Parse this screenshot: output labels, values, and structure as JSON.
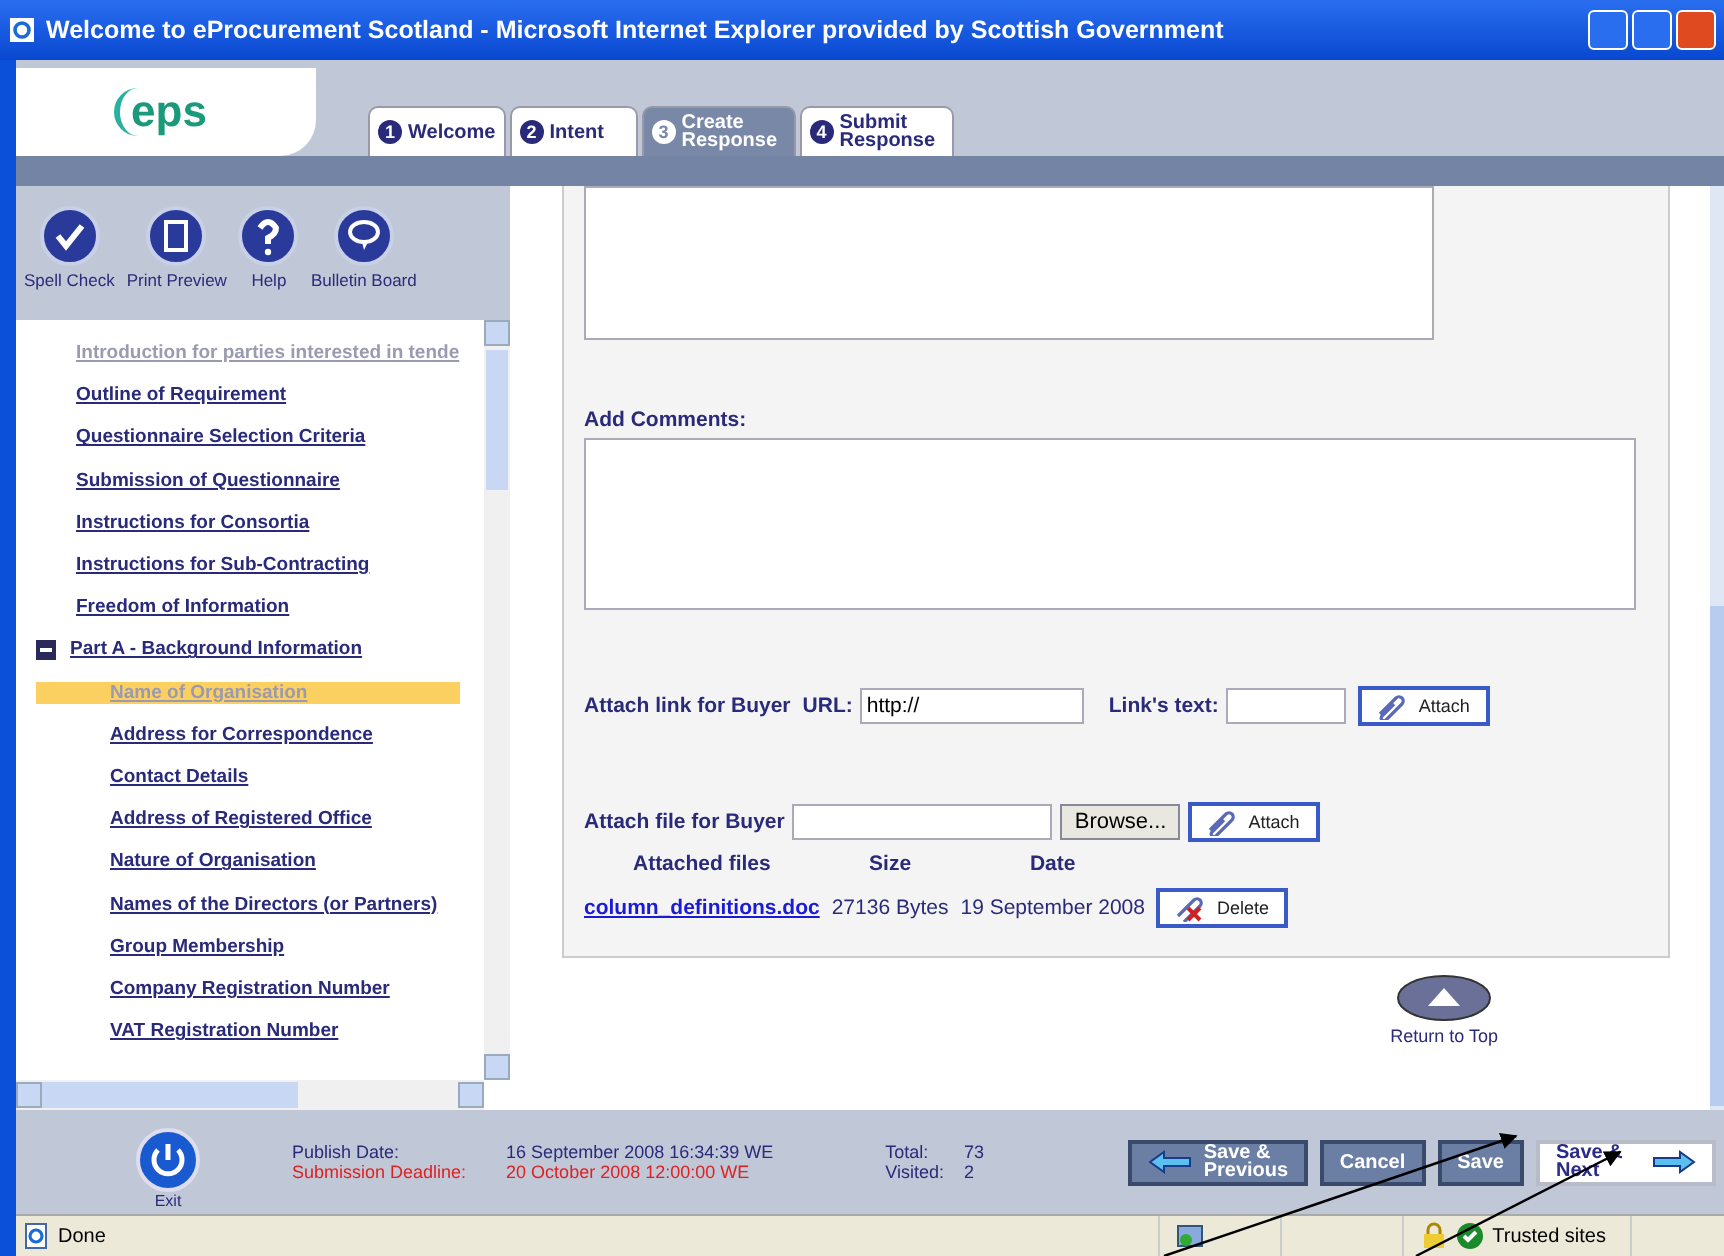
{
  "window": {
    "title": "Welcome to eProcurement Scotland - Microsoft Internet Explorer provided by Scottish Government"
  },
  "logo": {
    "text": "eps"
  },
  "tabs": [
    {
      "number": "1",
      "label": "Welcome",
      "selected": false
    },
    {
      "number": "2",
      "label": "Intent",
      "selected": false
    },
    {
      "number": "3",
      "label": "Create Response",
      "selected": true
    },
    {
      "number": "4",
      "label": "Submit Response",
      "selected": false
    }
  ],
  "toolbar": [
    {
      "kind": "spell",
      "label": "Spell Check"
    },
    {
      "kind": "print",
      "label": "Print Preview"
    },
    {
      "kind": "help",
      "label": "Help"
    },
    {
      "kind": "bulletin",
      "label": "Bulletin Board"
    }
  ],
  "tree": [
    {
      "label": "Introduction for parties interested in tende",
      "visited": true,
      "selected": false
    },
    {
      "label": "Outline of Requirement",
      "visited": false,
      "selected": false
    },
    {
      "label": "Questionnaire Selection Criteria",
      "visited": false,
      "selected": false
    },
    {
      "label": "Submission of Questionnaire",
      "visited": false,
      "selected": false
    },
    {
      "label": "Instructions for Consortia",
      "visited": false,
      "selected": false
    },
    {
      "label": "Instructions for Sub-Contracting",
      "visited": false,
      "selected": false
    },
    {
      "label": "Freedom of Information",
      "visited": false,
      "selected": false
    },
    {
      "label": "Part A - Background Information",
      "visited": false,
      "selected": false,
      "expanded": true,
      "children": [
        {
          "label": "Name of Organisation",
          "visited": true,
          "selected": true
        },
        {
          "label": "Address for Correspondence",
          "visited": false,
          "selected": false
        },
        {
          "label": "Contact Details",
          "visited": false,
          "selected": false
        },
        {
          "label": "Address of Registered Office",
          "visited": false,
          "selected": false
        },
        {
          "label": "Nature of Organisation",
          "visited": false,
          "selected": false
        },
        {
          "label": "Names of the Directors (or Partners)",
          "visited": false,
          "selected": false
        },
        {
          "label": "Group Membership",
          "visited": false,
          "selected": false
        },
        {
          "label": "Company Registration Number",
          "visited": false,
          "selected": false
        },
        {
          "label": "VAT Registration Number",
          "visited": false,
          "selected": false
        }
      ]
    }
  ],
  "form": {
    "comments_label": "Add Comments:",
    "link": {
      "label": "Attach link for Buyer",
      "url_label": "URL:",
      "url_value": "http://",
      "text_label": "Link's text:",
      "attach": "Attach"
    },
    "file": {
      "label": "Attach file for Buyer",
      "browse": "Browse...",
      "attach": "Attach"
    },
    "files_columns": [
      "Attached files",
      "Size",
      "Date"
    ],
    "files": [
      {
        "name": "column_definitions.doc",
        "size": "27136 Bytes",
        "date": "19 September 2008",
        "delete": "Delete"
      }
    ]
  },
  "return_to_top": "Return to Top",
  "footer": {
    "exit": "Exit",
    "info": [
      {
        "label": "Publish Date:",
        "value": "16 September 2008 16:34:39 WE",
        "color": "#2a2a7a"
      },
      {
        "label": "Submission Deadline:",
        "value": "20 October 2008 12:00:00 WE",
        "color": "#e02020"
      }
    ],
    "counts": [
      {
        "label": "Total:",
        "value": "73"
      },
      {
        "label": "Visited:",
        "value": "2"
      }
    ],
    "buttons": [
      {
        "label": "Save & Previous",
        "kind": "back",
        "highlighted": false
      },
      {
        "label": "Cancel",
        "kind": "plain",
        "highlighted": false
      },
      {
        "label": "Save",
        "kind": "plain",
        "highlighted": false
      },
      {
        "label": "Save & Next",
        "kind": "forward",
        "highlighted": true
      }
    ]
  },
  "status_bar": {
    "text": "Done",
    "zone": "Trusted sites"
  }
}
